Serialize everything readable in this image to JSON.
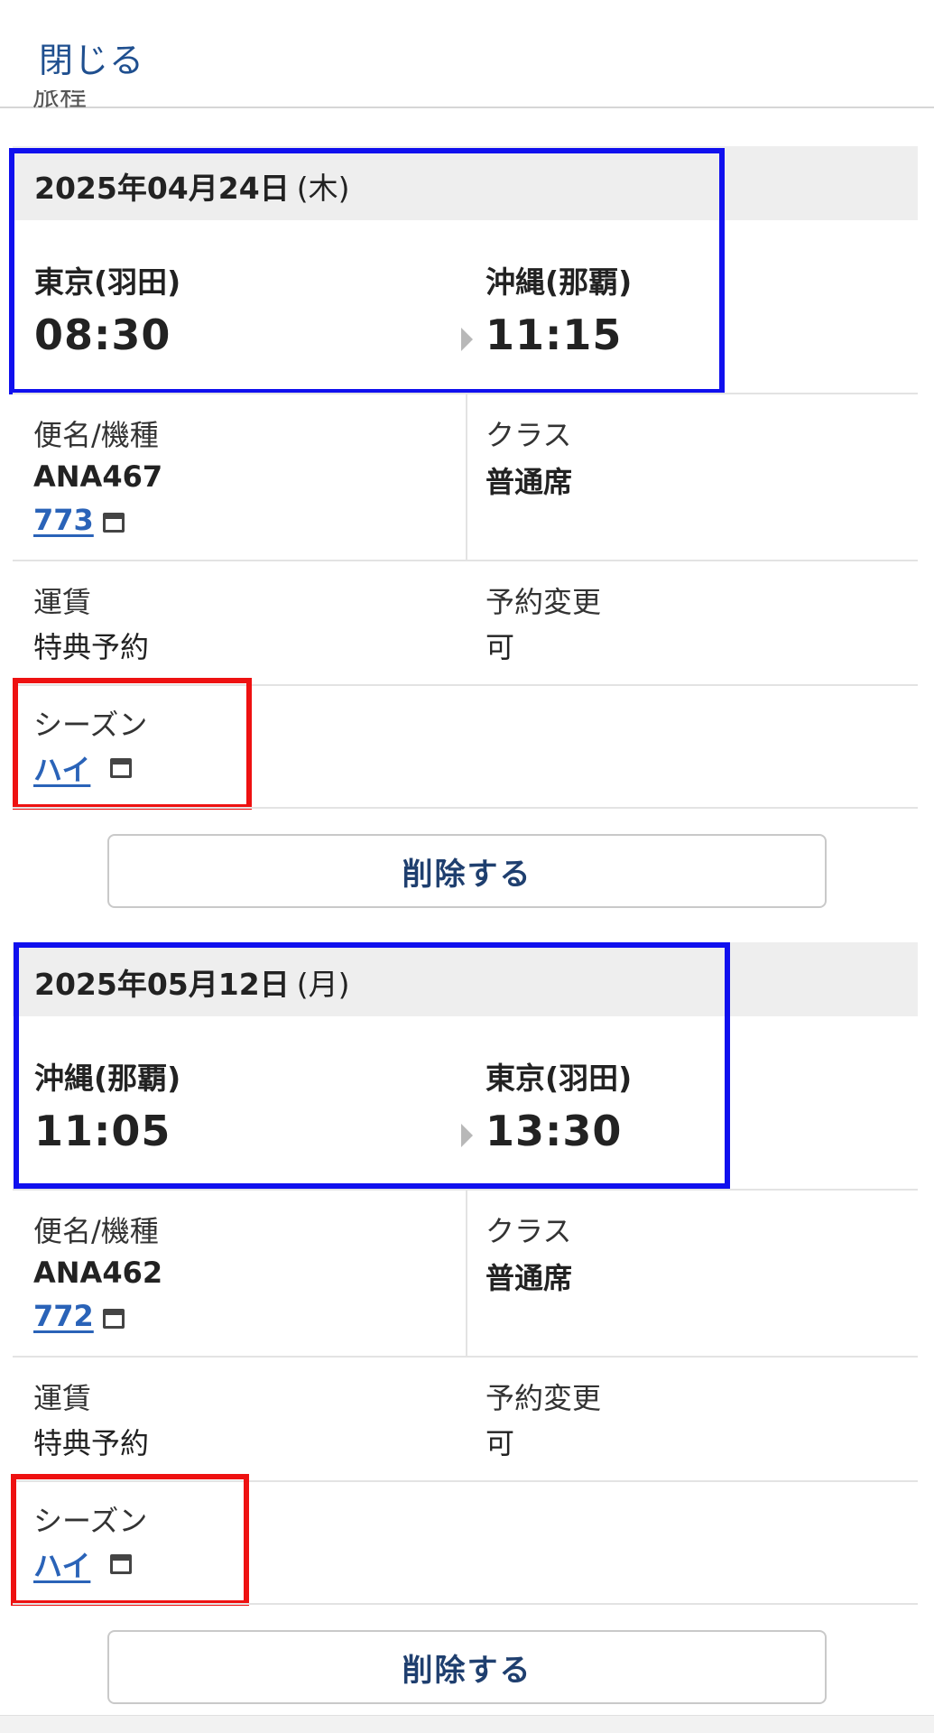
{
  "header": {
    "close_label": "閉じる",
    "peek_label": "旅程"
  },
  "segments": [
    {
      "date": "2025年04月24日",
      "weekday": "(木)",
      "departure_city": "東京(羽田)",
      "departure_time": "08:30",
      "arrival_city": "沖縄(那覇)",
      "arrival_time": "11:15",
      "flight_label": "便名/機種",
      "flight_number": "ANA467",
      "aircraft": "773",
      "class_label": "クラス",
      "class_value": "普通席",
      "fare_label": "運賃",
      "fare_value": "特典予約",
      "change_label": "予約変更",
      "change_value": "可",
      "season_label": "シーズン",
      "season_value": "ハイ",
      "delete_label": "削除する"
    },
    {
      "date": "2025年05月12日",
      "weekday": "(月)",
      "departure_city": "沖縄(那覇)",
      "departure_time": "11:05",
      "arrival_city": "東京(羽田)",
      "arrival_time": "13:30",
      "flight_label": "便名/機種",
      "flight_number": "ANA462",
      "aircraft": "772",
      "class_label": "クラス",
      "class_value": "普通席",
      "fare_label": "運賃",
      "fare_value": "特典予約",
      "change_label": "予約変更",
      "change_value": "可",
      "season_label": "シーズン",
      "season_value": "ハイ",
      "delete_label": "削除する"
    }
  ],
  "colors": {
    "highlight_blue": "#1010ee",
    "highlight_red": "#ee1111",
    "link": "#2a63b8",
    "close_link": "#1f4f8f"
  }
}
